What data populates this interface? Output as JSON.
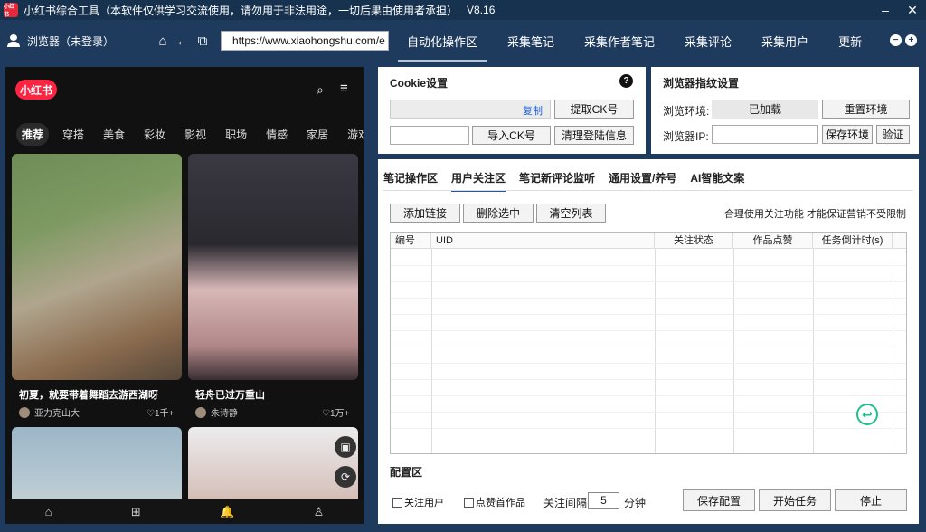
{
  "window": {
    "logo_text": "小红书",
    "title": "小红书综合工具（本软件仅供学习交流使用，请勿用于非法用途，一切后果由使用者承担）",
    "version": "V8.16",
    "minimize": "–",
    "close": "✕"
  },
  "nav": {
    "browser_label": "浏览器（未登录）",
    "url": "https://www.xiaohongshu.com/e",
    "tabs": [
      "自动化操作区",
      "采集笔记",
      "采集作者笔记",
      "采集评论",
      "采集用户",
      "更新"
    ]
  },
  "phone": {
    "logo": "小红书",
    "categories": [
      "推荐",
      "穿搭",
      "美食",
      "彩妆",
      "影视",
      "职场",
      "情感",
      "家居",
      "游戏"
    ],
    "cards": [
      {
        "title": "初夏，就要带着舞蹈去游西湖呀",
        "author": "亚力克山大",
        "likes": "♡1千+"
      },
      {
        "title": "轻舟已过万重山",
        "author": "朱诗静",
        "likes": "♡1万+"
      }
    ],
    "icons": {
      "search": "⌕",
      "menu": "≡",
      "image": "▣",
      "refresh": "⟳",
      "home": "⌂",
      "add": "⊞",
      "bell": "🔔",
      "profile": "♙"
    }
  },
  "cookie": {
    "title": "Cookie设置",
    "copy": "复制",
    "extract_btn": "提取CK号",
    "import_btn": "导入CK号",
    "clear_btn": "清理登陆信息",
    "help": "?"
  },
  "fingerprint": {
    "title": "浏览器指纹设置",
    "env_label": "浏览环境:",
    "env_value": "已加载",
    "reset_btn": "重置环境",
    "ip_label": "浏览器IP:",
    "save_env_btn": "保存环境",
    "verify_btn": "验证"
  },
  "main": {
    "subtabs": [
      "笔记操作区",
      "用户关注区",
      "笔记新评论监听",
      "通用设置/养号",
      "AI智能文案"
    ],
    "add_link_btn": "添加链接",
    "delete_btn": "删除选中",
    "clear_list_btn": "清空列表",
    "hint": "合理使用关注功能 才能保证营销不受限制",
    "columns": [
      "编号",
      "UID",
      "关注状态",
      "作品点赞",
      "任务倒计时(s)"
    ],
    "back_icon": "↩"
  },
  "config": {
    "title": "配置区",
    "follow_user": "关注用户",
    "like_first": "点赞首作品",
    "interval_label": "关注间隔",
    "interval_value": "5",
    "interval_unit": "分钟",
    "save_btn": "保存配置",
    "start_btn": "开始任务",
    "stop_btn": "停止"
  }
}
